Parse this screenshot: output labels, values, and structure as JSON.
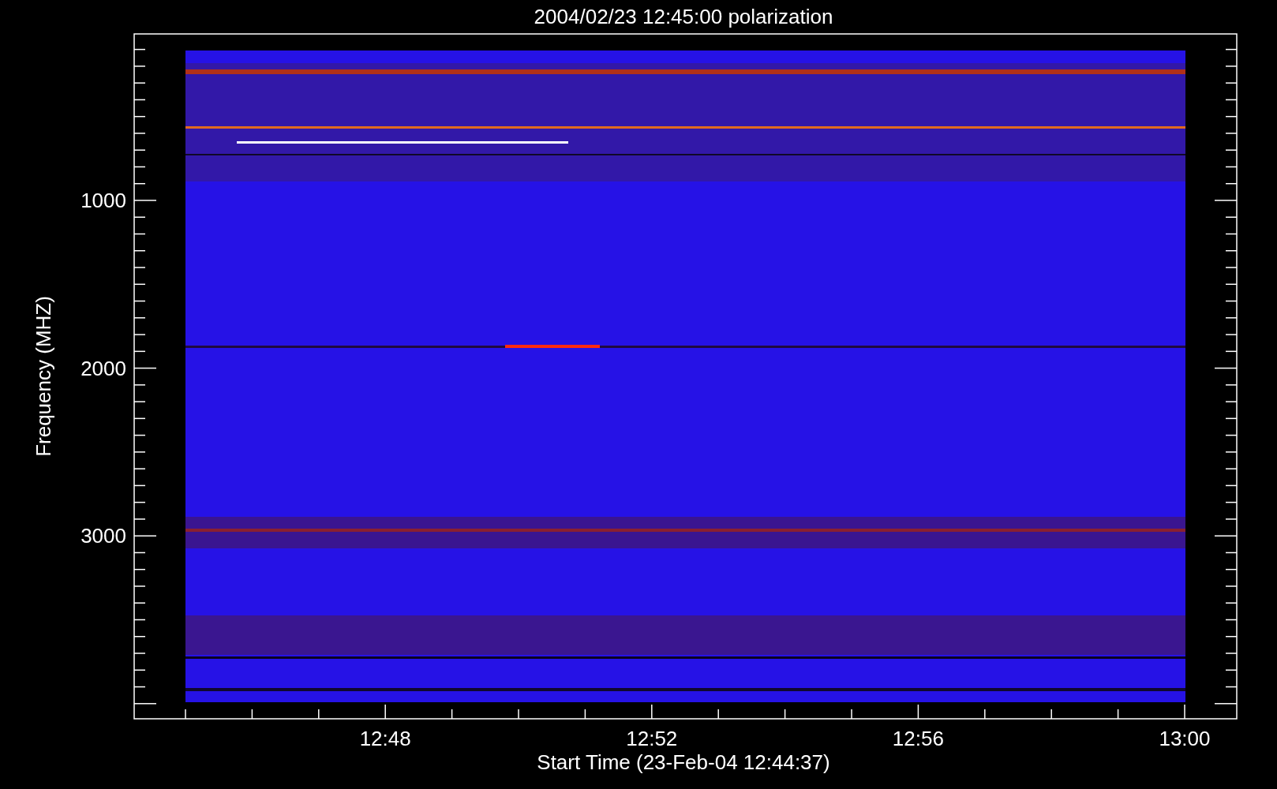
{
  "plot": {
    "title": "2004/02/23 12:45:00 polarization",
    "ylabel": "Frequency (MHZ)",
    "xlabel": "Start Time (23-Feb-04 12:44:37)",
    "yticks": [
      "1000",
      "2000",
      "3000"
    ],
    "xticks": [
      "12:48",
      "12:52",
      "12:56",
      "13:00"
    ]
  }
}
